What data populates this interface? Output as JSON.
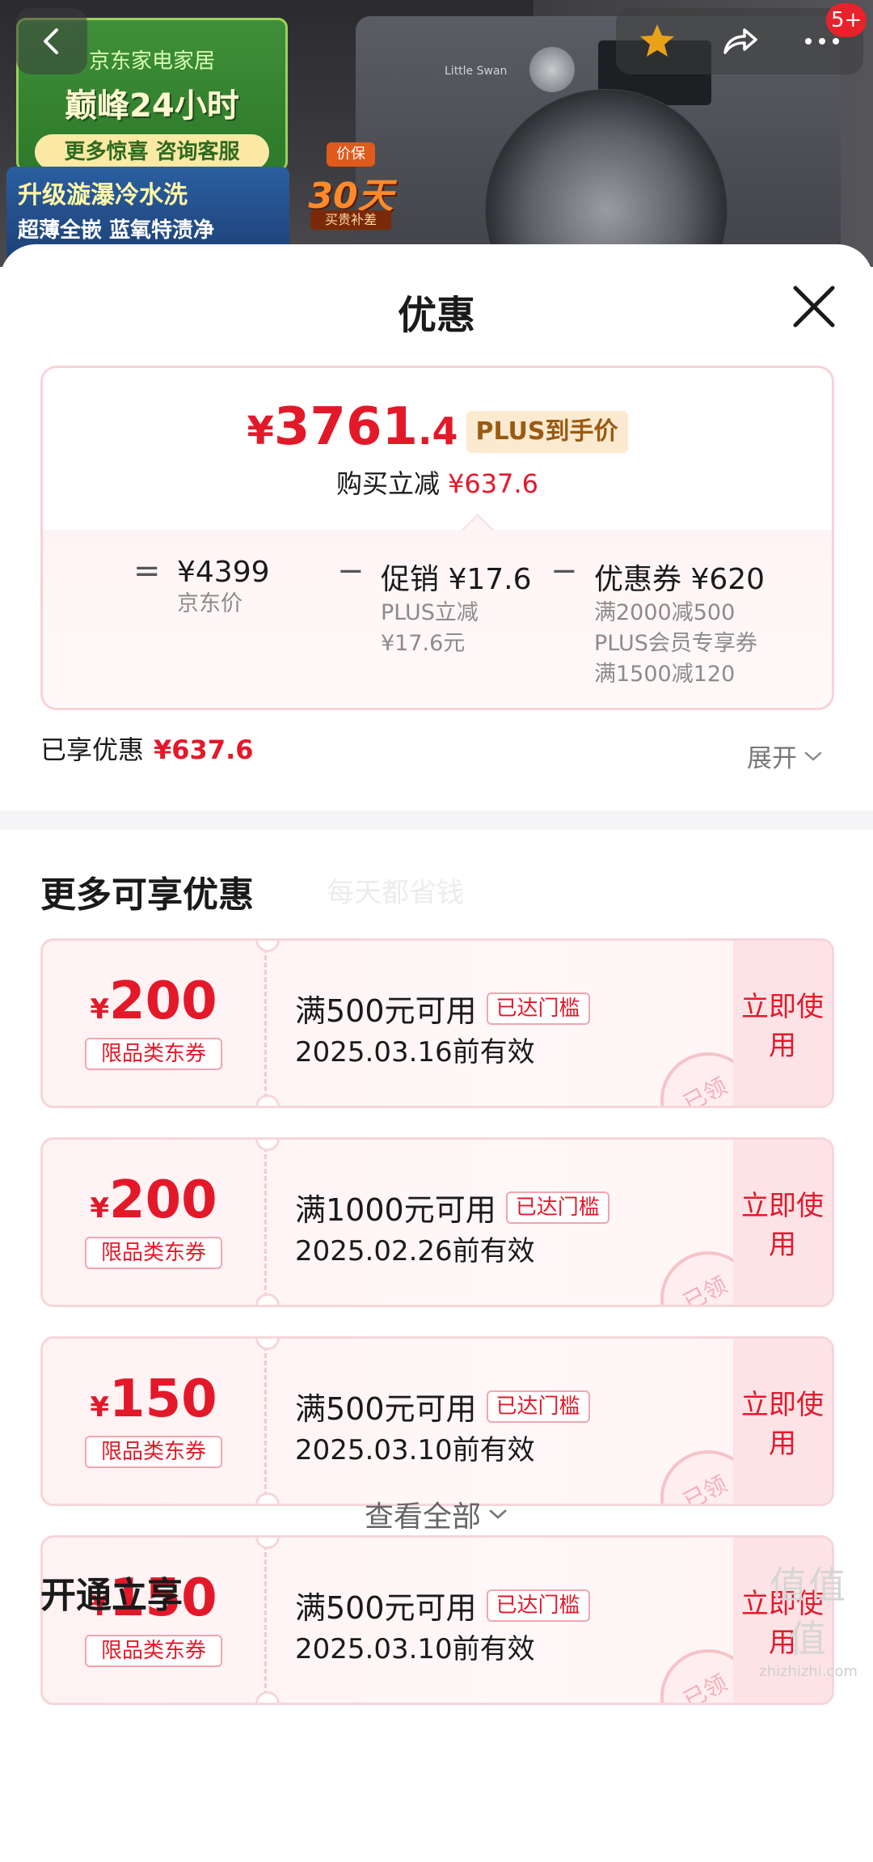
{
  "banner": {
    "promo_line1": "京东家电家居",
    "promo_line2": "巅峰24小时",
    "promo_pill": "更多惊喜 咨询客服",
    "promo_feature1": "升级漩瀑冷水洗",
    "promo_feature2": "超薄全嵌 蓝氧特渍净",
    "price_protect_top": "价保",
    "price_protect_days": "30天",
    "price_protect_sub": "买贵补差",
    "washer_brand": "Little Swan",
    "message_badge": "5+",
    "icons": [
      "back-arrow-icon",
      "star-icon",
      "share-icon",
      "more-icon"
    ],
    "star_color": "#e8a21a"
  },
  "sheet": {
    "title": "优惠"
  },
  "price": {
    "currency": "¥",
    "integer": "3761",
    "decimal": ".4",
    "tag": "PLUS到手价",
    "reduce_label": "购买立减",
    "reduce_amount": "¥637.6",
    "accent_color": "#e3192a"
  },
  "formula": {
    "eq": "=",
    "minus1": "−",
    "minus2": "−",
    "base_value": "¥4399",
    "base_label": "京东价",
    "promo_title": "促销 ¥17.6",
    "promo_sub1": "PLUS立减",
    "promo_sub2": "¥17.6元",
    "coupon_title": "优惠券 ¥620",
    "coupon_sub1": "满2000减500",
    "coupon_sub2": "PLUS会员专享券",
    "coupon_sub3": "满1500减120"
  },
  "enjoyed": {
    "label": "已享优惠",
    "amount": "¥637.6",
    "expand": "展开"
  },
  "more": {
    "title": "更多可享优惠",
    "watermark": "每天都省钱"
  },
  "coupons": [
    {
      "yen": "¥",
      "amount": "200",
      "type": "限品类东券",
      "condition": "满500元可用",
      "reached": "已达门槛",
      "expiry": "2025.03.16前有效",
      "use": "立即使用",
      "stamp": "已领"
    },
    {
      "yen": "¥",
      "amount": "200",
      "type": "限品类东券",
      "condition": "满1000元可用",
      "reached": "已达门槛",
      "expiry": "2025.02.26前有效",
      "use": "立即使用",
      "stamp": "已领"
    },
    {
      "yen": "¥",
      "amount": "150",
      "type": "限品类东券",
      "condition": "满500元可用",
      "reached": "已达门槛",
      "expiry": "2025.03.10前有效",
      "use": "立即使用",
      "stamp": "已领"
    },
    {
      "yen": "¥",
      "amount": "150",
      "type": "限品类东券",
      "condition": "满500元可用",
      "reached": "已达门槛",
      "expiry": "2025.03.10前有效",
      "use": "立即使用",
      "stamp": "已领"
    }
  ],
  "footer": {
    "view_all": "查看全部",
    "open_title": "开通立享",
    "site_mark": "值值值",
    "site_url": "zhizhizhi.com"
  }
}
